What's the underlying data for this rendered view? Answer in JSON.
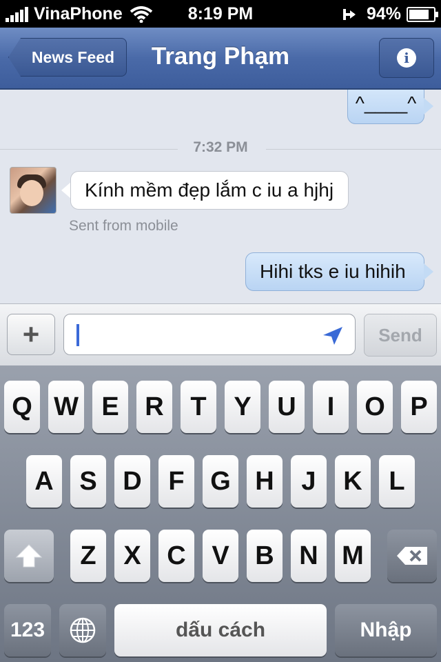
{
  "status": {
    "carrier": "VinaPhone",
    "time": "8:19 PM",
    "battery": "94%",
    "battery_level": 0.94
  },
  "nav": {
    "back_label": "News Feed",
    "title": "Trang Phạm",
    "info_icon": "info-icon"
  },
  "chat": {
    "messages": [
      {
        "direction": "outgoing",
        "text": "^____^"
      },
      {
        "direction": "incoming",
        "text": "Kính mềm đẹp lắm c iu a hjhj",
        "note": "Sent from mobile"
      },
      {
        "direction": "outgoing",
        "text": "Hihi tks e iu hihih"
      }
    ],
    "timestamp": "7:32 PM"
  },
  "composer": {
    "plus": "+",
    "placeholder": "",
    "send_label": "Send"
  },
  "keyboard": {
    "row1": [
      "Q",
      "W",
      "E",
      "R",
      "T",
      "Y",
      "U",
      "I",
      "O",
      "P"
    ],
    "row2": [
      "A",
      "S",
      "D",
      "F",
      "G",
      "H",
      "J",
      "K",
      "L"
    ],
    "row3": [
      "Z",
      "X",
      "C",
      "V",
      "B",
      "N",
      "M"
    ],
    "numbers_label": "123",
    "space_label": "dấu cách",
    "return_label": "Nhập"
  }
}
